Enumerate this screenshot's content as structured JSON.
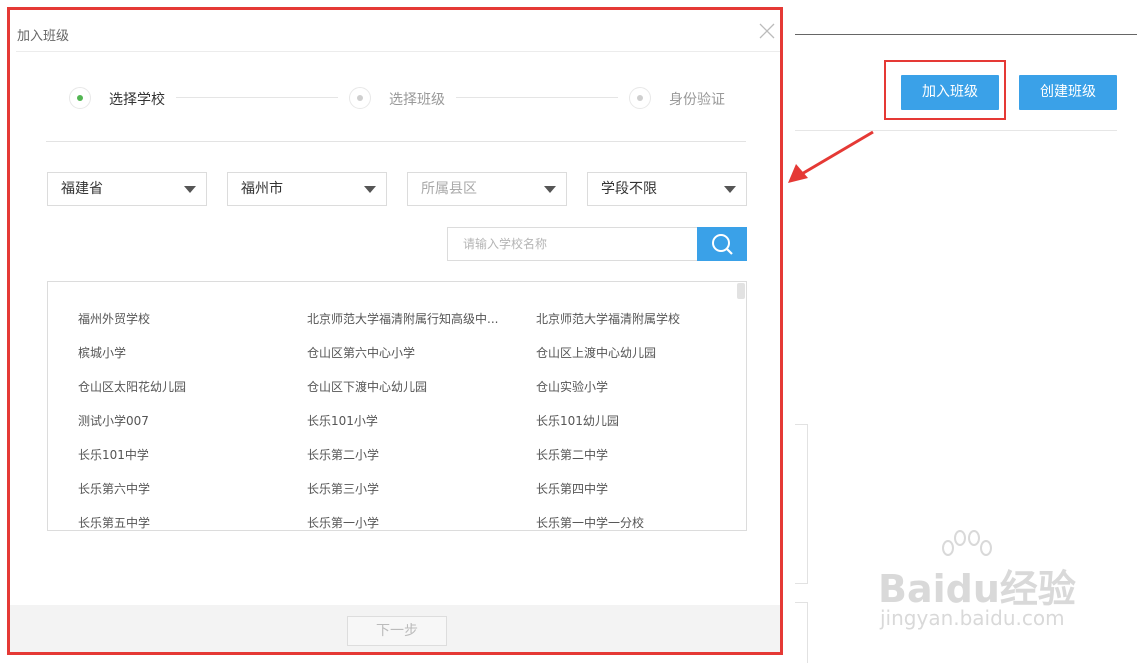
{
  "background_page": {
    "join_button": "加入班级",
    "create_button": "创建班级"
  },
  "modal": {
    "title": "加入班级",
    "close_icon": "close-icon",
    "steps": [
      {
        "label": "选择学校",
        "active": true
      },
      {
        "label": "选择班级",
        "active": false
      },
      {
        "label": "身份验证",
        "active": false
      }
    ],
    "filters": {
      "province": "福建省",
      "city": "福州市",
      "district_placeholder": "所属县区",
      "stage": "学段不限"
    },
    "search": {
      "placeholder": "请输入学校名称",
      "icon": "search-icon"
    },
    "schools": [
      "福州外贸学校",
      "北京师范大学福清附属行知高级中...",
      "北京师范大学福清附属学校",
      "槟城小学",
      "仓山区第六中心小学",
      "仓山区上渡中心幼儿园",
      "仓山区太阳花幼儿园",
      "仓山区下渡中心幼儿园",
      "仓山实验小学",
      "测试小学007",
      "长乐101小学",
      "长乐101幼儿园",
      "长乐101中学",
      "长乐第二小学",
      "长乐第二中学",
      "长乐第六中学",
      "长乐第三小学",
      "长乐第四中学",
      "长乐第五中学",
      "长乐第一小学",
      "长乐第一中学一分校"
    ],
    "next_button": "下一步"
  },
  "watermark": {
    "main": "Baidu经验",
    "sub": "jingyan.baidu.com"
  },
  "colors": {
    "accent": "#3aa1e8",
    "highlight": "#e53935",
    "step_active": "#52b552"
  }
}
